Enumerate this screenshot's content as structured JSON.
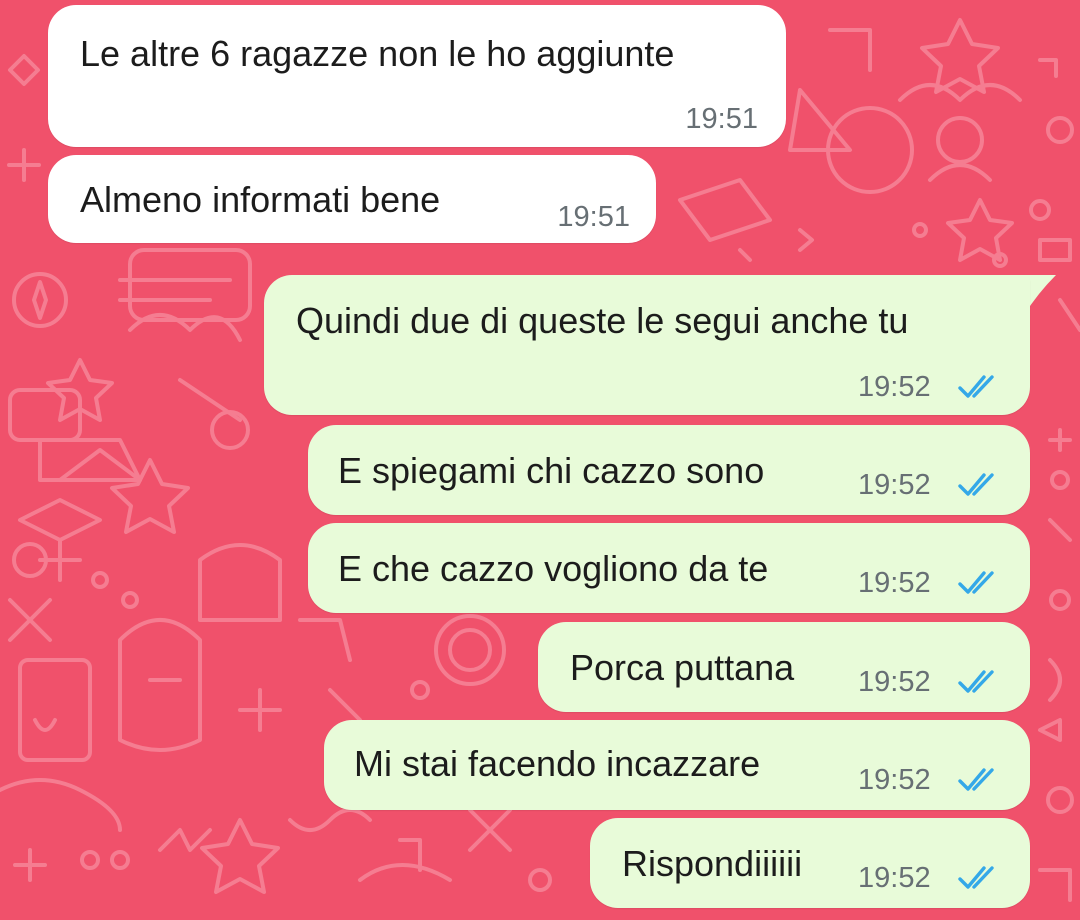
{
  "conversation": {
    "messages": [
      {
        "direction": "incoming",
        "text": "Le altre 6 ragazze non le ho aggiunte",
        "time": "19:51"
      },
      {
        "direction": "incoming",
        "text": "Almeno informati bene",
        "time": "19:51"
      },
      {
        "direction": "outgoing",
        "text": "Quindi due di queste le segui anche tu",
        "time": "19:52",
        "status": "read"
      },
      {
        "direction": "outgoing",
        "text": "E spiegami chi cazzo sono",
        "time": "19:52",
        "status": "read"
      },
      {
        "direction": "outgoing",
        "text": "E che cazzo vogliono da te",
        "time": "19:52",
        "status": "read"
      },
      {
        "direction": "outgoing",
        "text": "Porca puttana",
        "time": "19:52",
        "status": "read"
      },
      {
        "direction": "outgoing",
        "text": "Mi stai facendo incazzare",
        "time": "19:52",
        "status": "read"
      },
      {
        "direction": "outgoing",
        "text": "Rispondiiiiii",
        "time": "19:52",
        "status": "read"
      }
    ]
  },
  "theme": {
    "wallpaper_color": "#f0516b",
    "doodle_color": "#f57d91",
    "incoming_bubble": "#ffffff",
    "outgoing_bubble": "#e8fbd9",
    "read_tick_color": "#34a8e8",
    "time_color": "#676f74"
  },
  "icons": {
    "read_receipt": "double-check-icon"
  }
}
